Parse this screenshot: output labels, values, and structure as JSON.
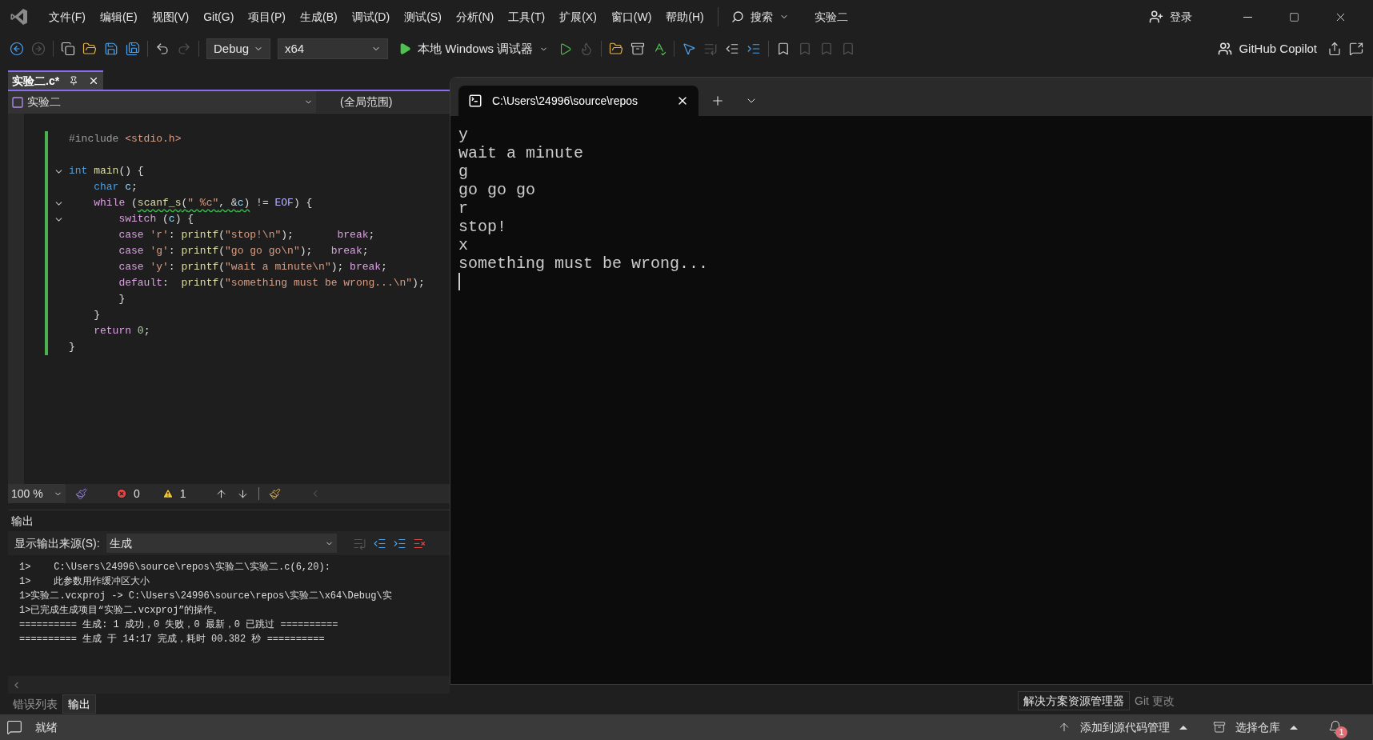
{
  "menu": [
    "文件(F)",
    "编辑(E)",
    "视图(V)",
    "Git(G)",
    "项目(P)",
    "生成(B)",
    "调试(D)",
    "测试(S)",
    "分析(N)",
    "工具(T)",
    "扩展(X)",
    "窗口(W)",
    "帮助(H)"
  ],
  "search": {
    "label": "搜索"
  },
  "solution_name": "实验二",
  "account": {
    "label": "登录"
  },
  "toolbar": {
    "configuration": "Debug",
    "platform": "x64",
    "debugger": "本地 Windows 调试器",
    "copilot": "GitHub Copilot"
  },
  "editor": {
    "tabs": [
      {
        "label": "实验二.c*",
        "selected": true
      }
    ],
    "project": "实验二",
    "scope": "(全局范围)",
    "lines": [
      {
        "fold": false,
        "tokens": [
          {
            "kind": "preprocessor",
            "text": "#include "
          },
          {
            "kind": "string",
            "text": "<stdio.h>"
          }
        ]
      },
      {
        "fold": false
      },
      {
        "fold": true,
        "tokens": [
          {
            "kind": "keyword",
            "text": "int "
          },
          {
            "kind": "function",
            "text": "main"
          },
          {
            "kind": "plain",
            "text": "() {"
          }
        ]
      },
      {
        "fold": false,
        "tokens": [
          {
            "kind": "keyword",
            "text": "    char "
          },
          {
            "kind": "variable",
            "text": "c"
          },
          {
            "kind": "plain",
            "text": ";"
          }
        ]
      },
      {
        "fold": true,
        "tokens": [
          {
            "kind": "control",
            "text": "    while "
          },
          {
            "kind": "plain",
            "text": "("
          },
          {
            "kind": "squiggle",
            "children": [
              {
                "kind": "function",
                "text": "scanf_s"
              },
              {
                "kind": "plain",
                "text": "("
              },
              {
                "kind": "string",
                "text": "\" %c\""
              },
              {
                "kind": "plain",
                "text": ", &"
              },
              {
                "kind": "variable",
                "text": "c"
              },
              {
                "kind": "plain",
                "text": ")"
              }
            ]
          },
          {
            "kind": "plain",
            "text": " != "
          },
          {
            "kind": "macro",
            "text": "EOF"
          },
          {
            "kind": "plain",
            "text": ") {"
          }
        ]
      },
      {
        "fold": true,
        "tokens": [
          {
            "kind": "control",
            "text": "        switch "
          },
          {
            "kind": "plain",
            "text": "("
          },
          {
            "kind": "variable",
            "text": "c"
          },
          {
            "kind": "plain",
            "text": ") {"
          }
        ]
      },
      {
        "fold": false,
        "tokens": [
          {
            "kind": "control",
            "text": "        case "
          },
          {
            "kind": "string",
            "text": "'r'"
          },
          {
            "kind": "plain",
            "text": ": "
          },
          {
            "kind": "function",
            "text": "printf"
          },
          {
            "kind": "plain",
            "text": "("
          },
          {
            "kind": "string",
            "text": "\"stop!\\n\""
          },
          {
            "kind": "plain",
            "text": ");       "
          },
          {
            "kind": "control",
            "text": "break"
          },
          {
            "kind": "plain",
            "text": ";"
          }
        ]
      },
      {
        "fold": false,
        "tokens": [
          {
            "kind": "control",
            "text": "        case "
          },
          {
            "kind": "string",
            "text": "'g'"
          },
          {
            "kind": "plain",
            "text": ": "
          },
          {
            "kind": "function",
            "text": "printf"
          },
          {
            "kind": "plain",
            "text": "("
          },
          {
            "kind": "string",
            "text": "\"go go go\\n\""
          },
          {
            "kind": "plain",
            "text": ");   "
          },
          {
            "kind": "control",
            "text": "break"
          },
          {
            "kind": "plain",
            "text": ";"
          }
        ]
      },
      {
        "fold": false,
        "tokens": [
          {
            "kind": "control",
            "text": "        case "
          },
          {
            "kind": "string",
            "text": "'y'"
          },
          {
            "kind": "plain",
            "text": ": "
          },
          {
            "kind": "function",
            "text": "printf"
          },
          {
            "kind": "plain",
            "text": "("
          },
          {
            "kind": "string",
            "text": "\"wait a minute\\n\""
          },
          {
            "kind": "plain",
            "text": "); "
          },
          {
            "kind": "control",
            "text": "break"
          },
          {
            "kind": "plain",
            "text": ";"
          }
        ]
      },
      {
        "fold": false,
        "tokens": [
          {
            "kind": "control",
            "text": "        default"
          },
          {
            "kind": "plain",
            "text": ":  "
          },
          {
            "kind": "function",
            "text": "printf"
          },
          {
            "kind": "plain",
            "text": "("
          },
          {
            "kind": "string",
            "text": "\"something must be wrong...\\n\""
          },
          {
            "kind": "plain",
            "text": ");"
          }
        ]
      },
      {
        "fold": false,
        "tokens": [
          {
            "kind": "plain",
            "text": "        }"
          }
        ]
      },
      {
        "fold": false,
        "tokens": [
          {
            "kind": "plain",
            "text": "    }"
          }
        ]
      },
      {
        "fold": false,
        "tokens": [
          {
            "kind": "control",
            "text": "    return "
          },
          {
            "kind": "number",
            "text": "0"
          },
          {
            "kind": "plain",
            "text": ";"
          }
        ]
      },
      {
        "fold": false,
        "tokens": [
          {
            "kind": "plain",
            "text": "}"
          }
        ]
      }
    ],
    "zoom": "100 %",
    "errors": "0",
    "warnings": "1"
  },
  "output": {
    "title": "输出",
    "source_label": "显示输出来源(S):",
    "source": "生成",
    "lines": [
      "1>    C:\\Users\\24996\\source\\repos\\实验二\\实验二.c(6,20):",
      "1>    此参数用作缓冲区大小",
      "1>实验二.vcxproj -> C:\\Users\\24996\\source\\repos\\实验二\\x64\\Debug\\实",
      "1>已完成生成项目“实验二.vcxproj”的操作。",
      "========== 生成: 1 成功，0 失败，0 最新，0 已跳过 ==========",
      "========== 生成 于 14:17 完成，耗时 00.382 秒 =========="
    ]
  },
  "left_bottom_tabs": [
    {
      "label": "错误列表",
      "selected": false
    },
    {
      "label": "输出",
      "selected": true
    }
  ],
  "terminal": {
    "tabs": [
      {
        "title": "C:\\Users\\24996\\source\\repos",
        "selected": true
      }
    ],
    "lines": [
      "y",
      "wait a minute",
      "g",
      "go go go",
      "r",
      "stop!",
      "x",
      "something must be wrong..."
    ]
  },
  "right_bottom_tabs": [
    {
      "label": "解决方案资源管理器",
      "selected": true
    },
    {
      "label": "Git 更改",
      "selected": false
    }
  ],
  "status_bar": {
    "message": "就绪",
    "source_control": "添加到源代码管理",
    "repository": "选择仓库",
    "notifications": "1"
  }
}
